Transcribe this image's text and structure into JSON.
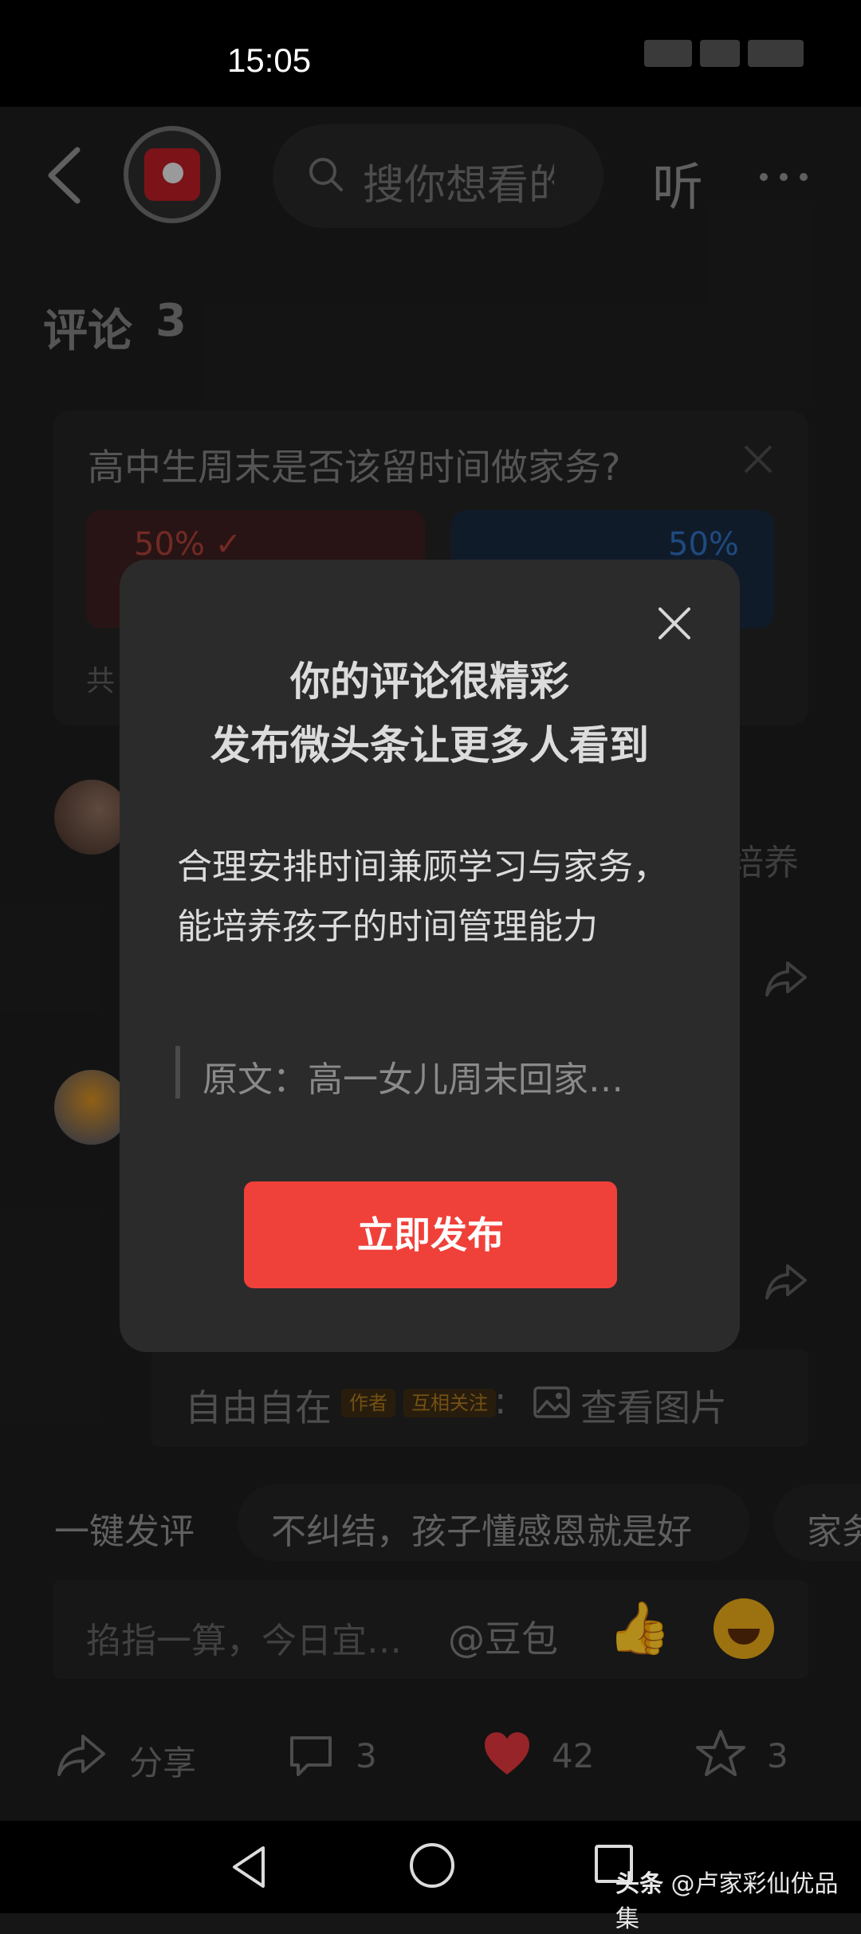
{
  "status_bar": {
    "time": "15:05"
  },
  "header": {
    "search_placeholder": "搜你想看的",
    "listen_label": "听"
  },
  "comments": {
    "title": "评论",
    "count": "3"
  },
  "poll": {
    "question": "高中生周末是否该留时间做家务?",
    "option_a_percent": "50% ✓",
    "option_b_percent": "50%",
    "total_prefix": "共"
  },
  "comment_list": {
    "first_tail": "培养"
  },
  "quote_strip": {
    "author": "自由自在",
    "badge_author": "作者",
    "badge_mutual": "互相关注",
    "colon": ":",
    "view_image": "查看图片"
  },
  "quick_comment": {
    "label": "一键发评",
    "chips": [
      "不纠结，孩子懂感恩就是好",
      "家务"
    ]
  },
  "input_bar": {
    "placeholder": "掐指一算，今日宜…",
    "mention": "@豆包"
  },
  "actions": {
    "share_label": "分享",
    "comment_count": "3",
    "like_count": "42",
    "star_count": "3",
    "like_color": "#d8343a"
  },
  "modal": {
    "title_line1": "你的评论很精彩",
    "title_line2": "发布微头条让更多人看到",
    "body": "合理安排时间兼顾学习与家务，能培养孩子的时间管理能力",
    "quote": "原文：高一女儿周末回家…",
    "publish_label": "立即发布",
    "publish_color": "#f0403a"
  },
  "watermark": {
    "brand": "头条",
    "handle": "@卢家彩仙优品集"
  }
}
